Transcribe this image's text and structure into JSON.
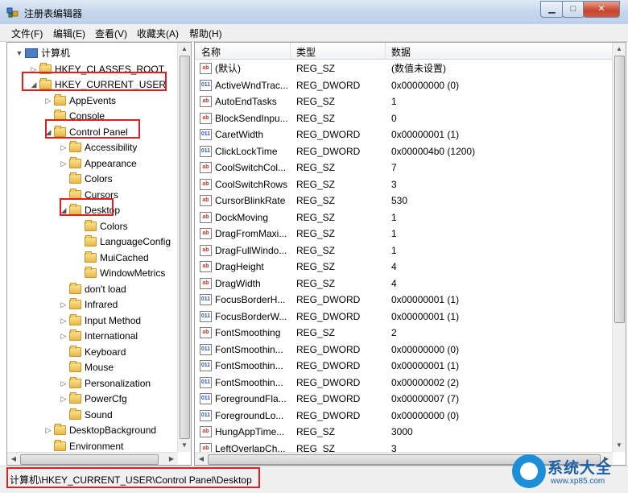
{
  "window": {
    "title": "注册表编辑器",
    "minimize": "▁",
    "maximize": "□",
    "close": "✕"
  },
  "menu": [
    "文件(F)",
    "编辑(E)",
    "查看(V)",
    "收藏夹(A)",
    "帮助(H)"
  ],
  "tree": [
    {
      "label": "计算机",
      "expander": "▼",
      "icon": "computer-icon"
    },
    {
      "label": "HKEY_CLASSES_ROOT",
      "expander": "▷",
      "icon": "folder-icon"
    },
    {
      "label": "HKEY_CURRENT_USER",
      "expander": "◢",
      "icon": "folder-icon"
    },
    {
      "label": "AppEvents",
      "expander": "▷",
      "icon": "folder-icon"
    },
    {
      "label": "Console",
      "expander": "",
      "icon": "folder-icon"
    },
    {
      "label": "Control Panel",
      "expander": "◢",
      "icon": "folder-icon"
    },
    {
      "label": "Accessibility",
      "expander": "▷",
      "icon": "folder-icon"
    },
    {
      "label": "Appearance",
      "expander": "▷",
      "icon": "folder-icon"
    },
    {
      "label": "Colors",
      "expander": "",
      "icon": "folder-icon"
    },
    {
      "label": "Cursors",
      "expander": "",
      "icon": "folder-icon"
    },
    {
      "label": "Desktop",
      "expander": "◢",
      "icon": "folder-icon"
    },
    {
      "label": "Colors",
      "expander": "",
      "icon": "folder-icon"
    },
    {
      "label": "LanguageConfig",
      "expander": "",
      "icon": "folder-icon"
    },
    {
      "label": "MuiCached",
      "expander": "",
      "icon": "folder-icon"
    },
    {
      "label": "WindowMetrics",
      "expander": "",
      "icon": "folder-icon"
    },
    {
      "label": "don't load",
      "expander": "",
      "icon": "folder-icon"
    },
    {
      "label": "Infrared",
      "expander": "▷",
      "icon": "folder-icon"
    },
    {
      "label": "Input Method",
      "expander": "▷",
      "icon": "folder-icon"
    },
    {
      "label": "International",
      "expander": "▷",
      "icon": "folder-icon"
    },
    {
      "label": "Keyboard",
      "expander": "",
      "icon": "folder-icon"
    },
    {
      "label": "Mouse",
      "expander": "",
      "icon": "folder-icon"
    },
    {
      "label": "Personalization",
      "expander": "▷",
      "icon": "folder-icon"
    },
    {
      "label": "PowerCfg",
      "expander": "▷",
      "icon": "folder-icon"
    },
    {
      "label": "Sound",
      "expander": "",
      "icon": "folder-icon"
    },
    {
      "label": "DesktopBackground",
      "expander": "▷",
      "icon": "folder-icon"
    },
    {
      "label": "Environment",
      "expander": "",
      "icon": "folder-icon"
    }
  ],
  "list": {
    "headers": [
      "名称",
      "类型",
      "数据"
    ],
    "rows": [
      {
        "name": "(默认)",
        "type": "REG_SZ",
        "data": "(数值未设置)",
        "icon": "ab"
      },
      {
        "name": "ActiveWndTrac...",
        "type": "REG_DWORD",
        "data": "0x00000000 (0)",
        "icon": "dword"
      },
      {
        "name": "AutoEndTasks",
        "type": "REG_SZ",
        "data": "1",
        "icon": "ab"
      },
      {
        "name": "BlockSendInpu...",
        "type": "REG_SZ",
        "data": "0",
        "icon": "ab"
      },
      {
        "name": "CaretWidth",
        "type": "REG_DWORD",
        "data": "0x00000001 (1)",
        "icon": "dword"
      },
      {
        "name": "ClickLockTime",
        "type": "REG_DWORD",
        "data": "0x000004b0 (1200)",
        "icon": "dword"
      },
      {
        "name": "CoolSwitchCol...",
        "type": "REG_SZ",
        "data": "7",
        "icon": "ab"
      },
      {
        "name": "CoolSwitchRows",
        "type": "REG_SZ",
        "data": "3",
        "icon": "ab"
      },
      {
        "name": "CursorBlinkRate",
        "type": "REG_SZ",
        "data": "530",
        "icon": "ab"
      },
      {
        "name": "DockMoving",
        "type": "REG_SZ",
        "data": "1",
        "icon": "ab"
      },
      {
        "name": "DragFromMaxi...",
        "type": "REG_SZ",
        "data": "1",
        "icon": "ab"
      },
      {
        "name": "DragFullWindo...",
        "type": "REG_SZ",
        "data": "1",
        "icon": "ab"
      },
      {
        "name": "DragHeight",
        "type": "REG_SZ",
        "data": "4",
        "icon": "ab"
      },
      {
        "name": "DragWidth",
        "type": "REG_SZ",
        "data": "4",
        "icon": "ab"
      },
      {
        "name": "FocusBorderH...",
        "type": "REG_DWORD",
        "data": "0x00000001 (1)",
        "icon": "dword"
      },
      {
        "name": "FocusBorderW...",
        "type": "REG_DWORD",
        "data": "0x00000001 (1)",
        "icon": "dword"
      },
      {
        "name": "FontSmoothing",
        "type": "REG_SZ",
        "data": "2",
        "icon": "ab"
      },
      {
        "name": "FontSmoothin...",
        "type": "REG_DWORD",
        "data": "0x00000000 (0)",
        "icon": "dword"
      },
      {
        "name": "FontSmoothin...",
        "type": "REG_DWORD",
        "data": "0x00000001 (1)",
        "icon": "dword"
      },
      {
        "name": "FontSmoothin...",
        "type": "REG_DWORD",
        "data": "0x00000002 (2)",
        "icon": "dword"
      },
      {
        "name": "ForegroundFla...",
        "type": "REG_DWORD",
        "data": "0x00000007 (7)",
        "icon": "dword"
      },
      {
        "name": "ForegroundLo...",
        "type": "REG_DWORD",
        "data": "0x00000000 (0)",
        "icon": "dword"
      },
      {
        "name": "HungAppTime...",
        "type": "REG_SZ",
        "data": "3000",
        "icon": "ab"
      },
      {
        "name": "LeftOverlapCh...",
        "type": "REG_SZ",
        "data": "3",
        "icon": "ab"
      }
    ]
  },
  "status": {
    "path": "计算机\\HKEY_CURRENT_USER\\Control Panel\\Desktop"
  },
  "watermark": {
    "text": "系统大全",
    "sub": "www.xp85.com"
  },
  "colors": {
    "highlight_box": "#e02020",
    "folder": "#f0cd6a"
  },
  "icons": {
    "ab": "ab",
    "dword": "011"
  }
}
